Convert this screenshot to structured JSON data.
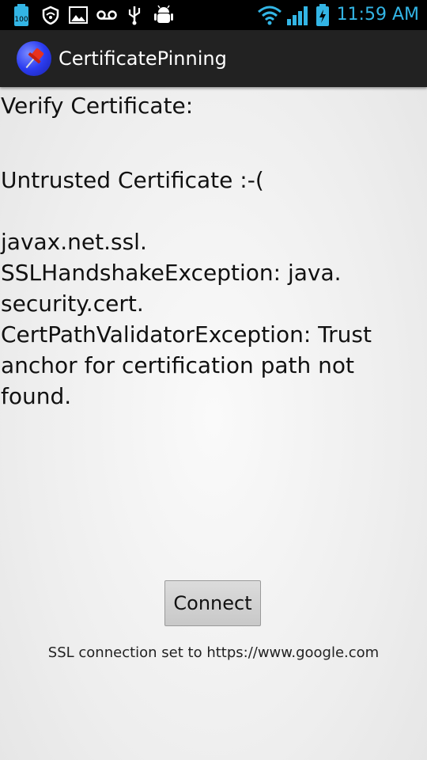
{
  "status_bar": {
    "time": "11:59 AM",
    "icons": [
      "battery-100-icon",
      "shield-icon",
      "image-icon",
      "voicemail-icon",
      "usb-icon",
      "android-debug-icon",
      "wifi-icon",
      "signal-icon",
      "battery-charging-icon"
    ],
    "battery_label": "100"
  },
  "action_bar": {
    "title": "CertificatePinning"
  },
  "main": {
    "verify_label": "Verify Certificate:",
    "result_label": "Untrusted Certificate :-(",
    "error_lines": [
      "javax.net.ssl.",
      "SSLHandshakeException: java.",
      "security.cert.",
      "CertPathValidatorException: Trust",
      "anchor for certification path not",
      "found."
    ],
    "connect_label": "Connect",
    "footer_text": "SSL connection set to https://www.google.com"
  },
  "colors": {
    "accent": "#33b5e5",
    "action_bar": "#222222",
    "status_bar": "#000000"
  }
}
